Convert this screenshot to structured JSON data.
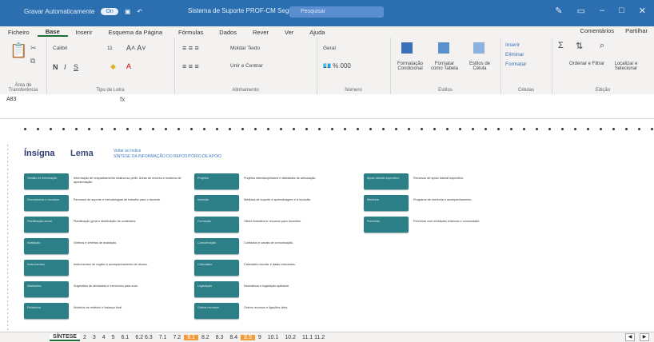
{
  "titlebar": {
    "autosave": "Gravar Automaticamente",
    "toggle": "On",
    "title": "Sistema de Suporte PROF-CM Seguro ...",
    "search": "Pesquisar"
  },
  "menu": {
    "items": [
      "Ficheiro",
      "Base",
      "Inserir",
      "Esquema da Página",
      "Fórmulas",
      "Dados",
      "Rever",
      "Ver",
      "Ajuda"
    ],
    "comments": "Comentários",
    "share": "Partilhar"
  },
  "ribbon": {
    "font_name": "Calibri",
    "font_size": "11",
    "wrap_text": "Moldar Texto",
    "merge_center": "Unir e Centrar",
    "number_format": "Geral",
    "cond_format": "Formatação Condicional",
    "format_table": "Formatar como Tabela",
    "cell_styles": "Estilos de Célula",
    "insert": "Inserir",
    "delete": "Eliminar",
    "format": "Formatar",
    "sort_filter": "Ordenar e Filtrar",
    "find_select": "Localizar e Selecionar",
    "groups": [
      "Área de Transferência",
      "Tipo de Letra",
      "Alinhamento",
      "Número",
      "Estilos",
      "Células",
      "Edição"
    ]
  },
  "formula": {
    "namebox": "A83",
    "fx": "fx"
  },
  "sheet": {
    "logo1": "Ínsígna",
    "logo2": "Lema",
    "header_line1": "Voltar ao índice",
    "header_line2": "SÍNTESE DA INFORMAÇÃO DO REPOSITÓRIO DE APOIO",
    "col1": [
      {
        "card": "Gestão de informação",
        "desc": "Informação de enquadramento relativa ao perfil. Áreas de recurso e modelos de apresentação."
      },
      {
        "card": "Documentos e recursos",
        "desc": "Recursos de suporte e metodologias de trabalho para o docente."
      },
      {
        "card": "Planificação anual",
        "desc": "Planificação geral e distribuição de conteúdos."
      },
      {
        "card": "Avaliação",
        "desc": "Grelhas e critérios de avaliação."
      },
      {
        "card": "Instrumentos",
        "desc": "Instrumentos de registo e acompanhamento de alunos."
      },
      {
        "card": "Atividades",
        "desc": "Sugestões de atividades e exercícios para aula."
      },
      {
        "card": "Relatórios",
        "desc": "Modelos de relatório e balanço final."
      }
    ],
    "col2": [
      {
        "card": "Projetos",
        "desc": "Projetos interdisciplinares e atividades de articulação."
      },
      {
        "card": "Inclusão",
        "desc": "Medidas de suporte à aprendizagem e à inclusão."
      },
      {
        "card": "Formação",
        "desc": "Oferta formativa e recursos para docentes."
      },
      {
        "card": "Comunicação",
        "desc": "Contactos e canais de comunicação."
      },
      {
        "card": "Calendário",
        "desc": "Calendário escolar e datas relevantes."
      },
      {
        "card": "Legislação",
        "desc": "Normativos e legislação aplicável."
      },
      {
        "card": "Outros recursos",
        "desc": "Outros recursos e ligações úteis."
      }
    ],
    "col3": [
      {
        "card": "Apoio tutorial específico",
        "desc": "Recursos de apoio tutorial específico."
      },
      {
        "card": "Mentoria",
        "desc": "Programa de mentoria e acompanhamento."
      },
      {
        "card": "Parcerias",
        "desc": "Parcerias com entidades externas e comunidade."
      }
    ]
  },
  "tabs": [
    "SÍNTESE",
    "2",
    "3",
    "4",
    "5",
    "6.1",
    "6.2 6.3",
    "7.1",
    "7.2",
    "8.1",
    "8.2",
    "8.3",
    "8.4",
    "8.5",
    "9",
    "10.1",
    "10.2",
    "11.1 11.2"
  ]
}
